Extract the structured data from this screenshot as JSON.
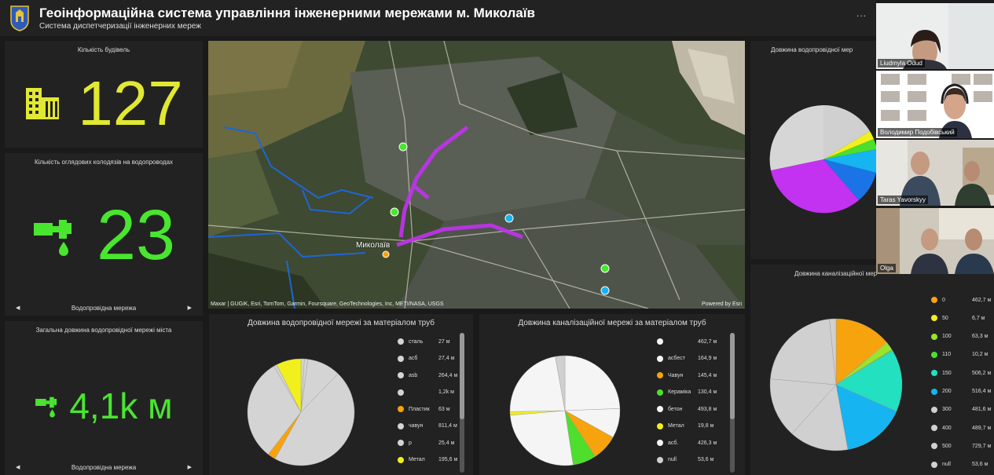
{
  "header": {
    "title": "Геоінформаційна система управління інженерними мережами м. Миколаїв",
    "subtitle": "Система диспетчеризації інженерних мереж",
    "menu_dots": "..."
  },
  "indicators": {
    "buildings": {
      "title": "Кількість будівель",
      "value": "127",
      "icon": "building-icon",
      "color": "#e1e831"
    },
    "wells": {
      "title": "Кількість оглядових колодязів на водопроводах",
      "value": "23",
      "icon": "water-tap-icon",
      "color": "#49e62f",
      "nav_label": "Водопровідна мережа"
    },
    "length": {
      "title": "Загальна довжина водопровідної мережі міста",
      "value": "4,1k м",
      "icon": "water-tap-icon",
      "color": "#49e62f",
      "nav_label": "Водопровідна мережа"
    }
  },
  "map": {
    "attribution": "Maxar | GUGiK, Esri, TomTom, Garmin, Foursquare, GeoTechnologies, Inc, METI/NASA, USGS",
    "powered": "Powered by Esri",
    "city_label": "Миколаїв"
  },
  "charts": {
    "water_material_title": "Довжина водопровідної мережі за матеріалом труб",
    "sewer_material_title": "Довжина каналізаційної мережі за матеріалом труб",
    "water_diameter_title": "Довжина водопровідної мер",
    "sewer_diameter_title": "Довжина каналізаційної мер"
  },
  "chart_data": [
    {
      "type": "pie",
      "title": "Довжина водопровідної мережі за матеріалом труб",
      "categories": [
        "сталь",
        "асб",
        "asb",
        "",
        "Пластик",
        "чавун",
        "p",
        "Метал"
      ],
      "values": [
        27,
        27.4,
        264.4,
        1200,
        63,
        811.4,
        25.4,
        195.6
      ],
      "labels": [
        "27 м",
        "27,4 м",
        "264,4 м",
        "1,2k м",
        "63 м",
        "811,4 м",
        "25,4 м",
        "195,6 м"
      ],
      "colors": [
        "#d4d4d4",
        "#d4d4d4",
        "#d4d4d4",
        "#d4d4d4",
        "#f7a30d",
        "#d4d4d4",
        "#d4d4d4",
        "#f2f01c"
      ]
    },
    {
      "type": "pie",
      "title": "Довжина каналізаційної мережі за матеріалом труб",
      "categories": [
        "",
        "асбест",
        "Чавун",
        "Кераміка",
        "бетон",
        "Метал",
        "асб.",
        "null"
      ],
      "values": [
        462.7,
        164.9,
        145.4,
        130.4,
        493.8,
        19.8,
        426.3,
        53.6
      ],
      "labels": [
        "462,7 м",
        "164,9 м",
        "145,4 м",
        "130,4 м",
        "493,8 м",
        "19,8 м",
        "426,3 м",
        "53,6 м"
      ],
      "colors": [
        "#f5f5f5",
        "#f5f5f5",
        "#f7a30d",
        "#4ddf2c",
        "#f5f5f5",
        "#f2f01c",
        "#f5f5f5",
        "#d0d0d0"
      ]
    },
    {
      "type": "pie",
      "title": "Довжина каналізаційної мер",
      "categories": [
        "0",
        "50",
        "100",
        "110",
        "150",
        "200",
        "300",
        "400",
        "500",
        "null"
      ],
      "values": [
        462.7,
        6.7,
        63.3,
        10.2,
        506.2,
        516.4,
        481.6,
        489.7,
        729.7,
        53.6
      ],
      "labels": [
        "462,7 м",
        "6,7 м",
        "63,3 м",
        "10,2 м",
        "506,2 м",
        "516,4 м",
        "481,6 м",
        "489,7 м",
        "729,7 м",
        "53,6 м"
      ],
      "colors": [
        "#f7a30d",
        "#f2f01c",
        "#98e52c",
        "#4ddf2c",
        "#22e0c0",
        "#16b4f0",
        "#d0d0d0",
        "#d0d0d0",
        "#d0d0d0",
        "#d0d0d0"
      ]
    }
  ],
  "video": [
    {
      "name": "Liudmyla Odud"
    },
    {
      "name": "Володимир Подобівський"
    },
    {
      "name": "Taras Yavorskyy"
    },
    {
      "name": "Olga"
    }
  ]
}
